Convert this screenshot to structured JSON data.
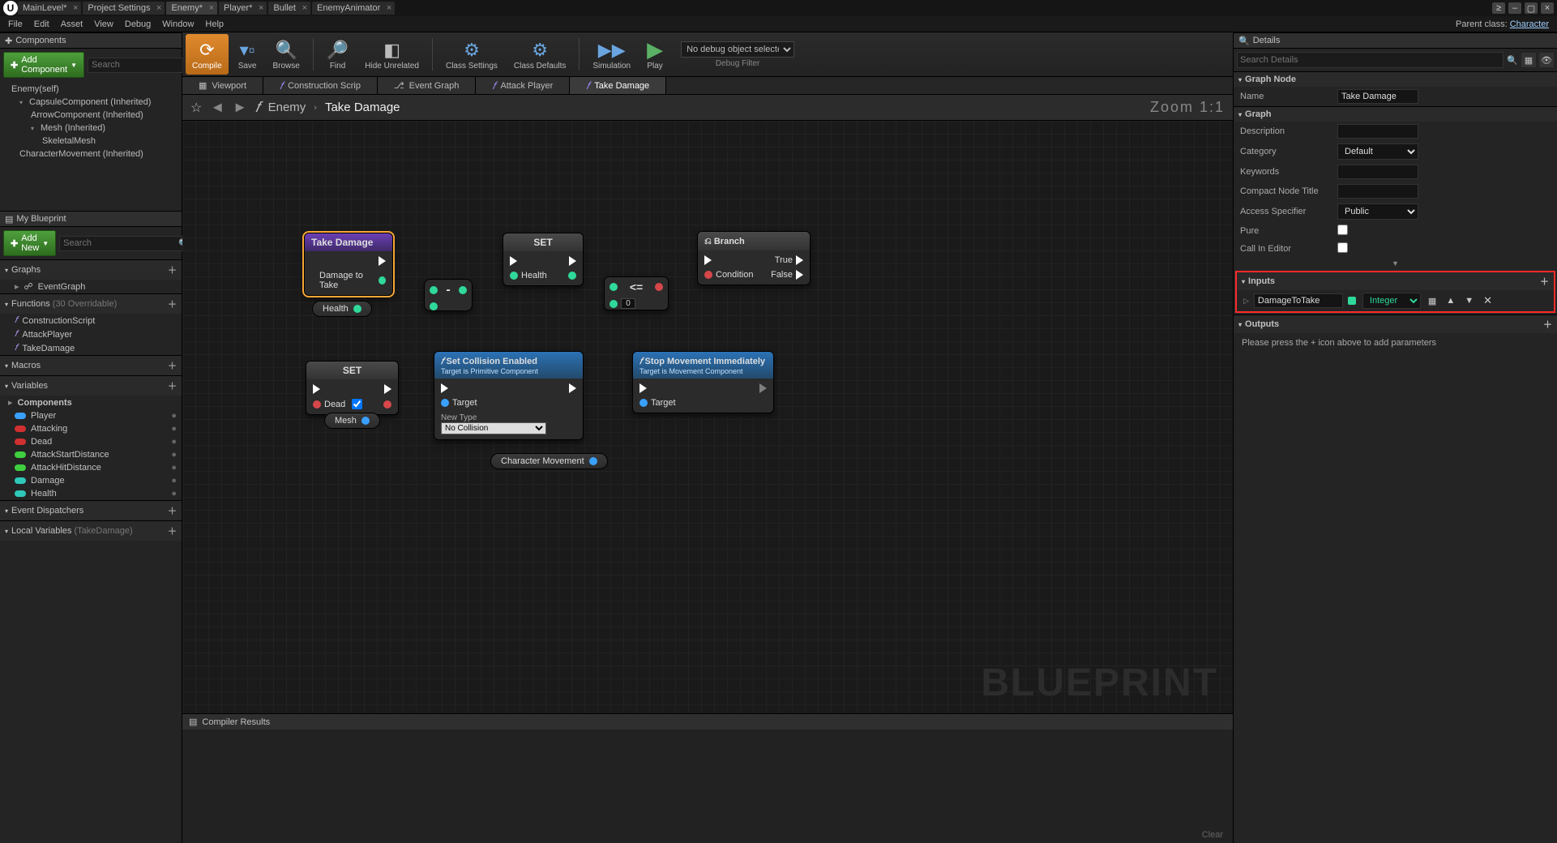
{
  "titlebar": {
    "tabs": [
      {
        "label": "MainLevel*"
      },
      {
        "label": "Project Settings"
      },
      {
        "label": "Enemy*",
        "active": true
      },
      {
        "label": "Player*"
      },
      {
        "label": "Bullet"
      },
      {
        "label": "EnemyAnimator"
      }
    ]
  },
  "menubar": {
    "items": [
      "File",
      "Edit",
      "Asset",
      "View",
      "Debug",
      "Window",
      "Help"
    ],
    "parent_label": "Parent class:",
    "parent_link": "Character"
  },
  "components_panel": {
    "title": "Components",
    "add_label": "Add Component",
    "search_placeholder": "Search",
    "self": "Enemy(self)",
    "items": [
      {
        "label": "CapsuleComponent (Inherited)",
        "lvl": 1
      },
      {
        "label": "ArrowComponent (Inherited)",
        "lvl": 2
      },
      {
        "label": "Mesh (Inherited)",
        "lvl": 2
      },
      {
        "label": "SkeletalMesh",
        "lvl": 3
      },
      {
        "label": "CharacterMovement (Inherited)",
        "lvl": 1
      }
    ]
  },
  "myblueprint": {
    "title": "My Blueprint",
    "add_label": "Add New",
    "search_placeholder": "Search",
    "sections": {
      "graphs": {
        "title": "Graphs",
        "items": [
          {
            "label": "EventGraph"
          }
        ]
      },
      "functions": {
        "title": "Functions",
        "hint": "(30 Overridable)",
        "items": [
          {
            "label": "ConstructionScript"
          },
          {
            "label": "AttackPlayer"
          },
          {
            "label": "TakeDamage"
          }
        ]
      },
      "macros": {
        "title": "Macros",
        "items": []
      },
      "variables": {
        "title": "Variables",
        "items": [
          {
            "label": "Components",
            "sub": true
          },
          {
            "label": "Player",
            "color": "blue"
          },
          {
            "label": "Attacking",
            "color": "red"
          },
          {
            "label": "Dead",
            "color": "red"
          },
          {
            "label": "AttackStartDistance",
            "color": "green"
          },
          {
            "label": "AttackHitDistance",
            "color": "green"
          },
          {
            "label": "Damage",
            "color": "teal"
          },
          {
            "label": "Health",
            "color": "teal"
          }
        ]
      },
      "dispatchers": {
        "title": "Event Dispatchers",
        "items": []
      },
      "locals": {
        "title": "Local Variables",
        "hint": "(TakeDamage)",
        "items": []
      }
    }
  },
  "toolbar": {
    "buttons": [
      {
        "label": "Compile",
        "ico": "⟳",
        "hl": true,
        "drop": true
      },
      {
        "label": "Save",
        "ico": "💾"
      },
      {
        "label": "Browse",
        "ico": "🔍"
      },
      {
        "sep": true
      },
      {
        "label": "Find",
        "ico": "🔎"
      },
      {
        "label": "Hide Unrelated",
        "ico": "◧",
        "drop": true
      },
      {
        "sep": true
      },
      {
        "label": "Class Settings",
        "ico": "⚙"
      },
      {
        "label": "Class Defaults",
        "ico": "⚙"
      },
      {
        "sep": true
      },
      {
        "label": "Simulation",
        "ico": "▶"
      },
      {
        "label": "Play",
        "ico": "▶",
        "drop": true
      }
    ],
    "debug_select": "No debug object selected",
    "debug_label": "Debug Filter"
  },
  "editor_tabs": [
    {
      "label": "Viewport",
      "ico": "▦"
    },
    {
      "label": "Construction Scrip",
      "fi": true
    },
    {
      "label": "Event Graph",
      "ico": "⎇"
    },
    {
      "label": "Attack Player",
      "fi": true
    },
    {
      "label": "Take Damage",
      "fi": true,
      "active": true
    }
  ],
  "breadcrumb": {
    "root": "Enemy",
    "current": "Take Damage",
    "zoom": "Zoom 1:1"
  },
  "graph": {
    "watermark": "BLUEPRINT",
    "nodes": {
      "take_damage": {
        "title": "Take Damage",
        "input": "Damage to Take"
      },
      "set_health": {
        "title": "SET",
        "pin": "Health"
      },
      "health_var": "Health",
      "subtract": "-",
      "less_eq": {
        "op": "<=",
        "val": "0"
      },
      "branch": {
        "title": "Branch",
        "in": "Condition",
        "true": "True",
        "false": "False"
      },
      "set_dead": {
        "title": "SET",
        "pin": "Dead"
      },
      "mesh_var": "Mesh",
      "char_move": "Character Movement",
      "set_collision": {
        "title": "Set Collision Enabled",
        "sub": "Target is Primitive Component",
        "target": "Target",
        "newtype": "New Type",
        "sel": "No Collision"
      },
      "stop_move": {
        "title": "Stop Movement Immediately",
        "sub": "Target is Movement Component",
        "target": "Target"
      }
    }
  },
  "compiler": {
    "title": "Compiler Results",
    "clear": "Clear"
  },
  "details": {
    "title": "Details",
    "search_placeholder": "Search Details",
    "graph_node": {
      "title": "Graph Node",
      "name_k": "Name",
      "name_v": "Take Damage"
    },
    "graph": {
      "title": "Graph",
      "rows": [
        {
          "k": "Description",
          "type": "text",
          "v": ""
        },
        {
          "k": "Category",
          "type": "select",
          "v": "Default"
        },
        {
          "k": "Keywords",
          "type": "text",
          "v": ""
        },
        {
          "k": "Compact Node Title",
          "type": "text",
          "v": ""
        },
        {
          "k": "Access Specifier",
          "type": "select",
          "v": "Public"
        },
        {
          "k": "Pure",
          "type": "check",
          "v": false
        },
        {
          "k": "Call In Editor",
          "type": "check",
          "v": false
        }
      ]
    },
    "inputs": {
      "title": "Inputs",
      "param": {
        "name": "DamageToTake",
        "type": "Integer"
      }
    },
    "outputs": {
      "title": "Outputs",
      "empty": "Please press the + icon above to add parameters"
    }
  }
}
